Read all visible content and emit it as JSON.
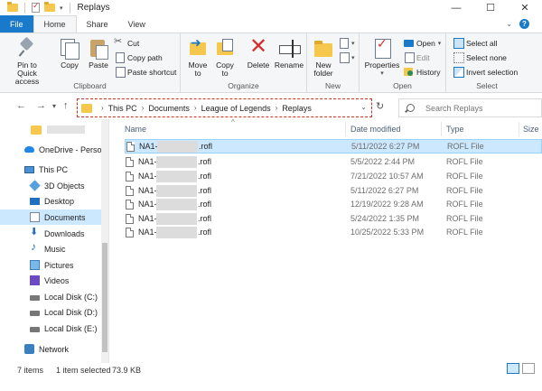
{
  "window": {
    "title": "Replays",
    "controls": {
      "minimize": "—",
      "maximize": "☐",
      "close": "✕"
    }
  },
  "ribbon_tabs": [
    "File",
    "Home",
    "Share",
    "View"
  ],
  "ribbon": {
    "clipboard": {
      "label": "Clipboard",
      "pin": "Pin to Quick access",
      "pin_l1": "Pin to Quick",
      "pin_l2": "access",
      "copy": "Copy",
      "paste": "Paste",
      "cut": "Cut",
      "copy_path": "Copy path",
      "paste_shortcut": "Paste shortcut"
    },
    "organize": {
      "label": "Organize",
      "move_to_l1": "Move",
      "move_to_l2": "to",
      "copy_to_l1": "Copy",
      "copy_to_l2": "to",
      "delete": "Delete",
      "rename": "Rename"
    },
    "new": {
      "label": "New",
      "new_folder_l1": "New",
      "new_folder_l2": "folder"
    },
    "open": {
      "label": "Open",
      "properties": "Properties",
      "open": "Open",
      "edit": "Edit",
      "history": "History"
    },
    "select": {
      "label": "Select",
      "select_all": "Select all",
      "select_none": "Select none",
      "invert_selection": "Invert selection"
    }
  },
  "address": {
    "breadcrumbs": [
      "This PC",
      "Documents",
      "League of Legends",
      "Replays"
    ]
  },
  "search": {
    "placeholder": "Search Replays"
  },
  "nav_pane": {
    "items": [
      {
        "label": "OneDrive - Persor",
        "icon": "cloud-icon"
      },
      {
        "label": "This PC",
        "icon": "computer-icon"
      },
      {
        "label": "3D Objects",
        "icon": "cube-icon"
      },
      {
        "label": "Desktop",
        "icon": "desktop-icon"
      },
      {
        "label": "Documents",
        "icon": "document-icon",
        "selected": true
      },
      {
        "label": "Downloads",
        "icon": "download-icon"
      },
      {
        "label": "Music",
        "icon": "music-icon"
      },
      {
        "label": "Pictures",
        "icon": "picture-icon"
      },
      {
        "label": "Videos",
        "icon": "video-icon"
      },
      {
        "label": "Local Disk (C:)",
        "icon": "drive-icon"
      },
      {
        "label": "Local Disk (D:)",
        "icon": "drive-icon"
      },
      {
        "label": "Local Disk (E:)",
        "icon": "drive-icon"
      },
      {
        "label": "Network",
        "icon": "network-icon"
      }
    ]
  },
  "file_list": {
    "columns": [
      "Name",
      "Date modified",
      "Type",
      "Size"
    ],
    "rows": [
      {
        "name_prefix": "NA1-",
        "name_suffix": ".rofl",
        "date": "5/11/2022 6:27 PM",
        "type": "ROFL File",
        "selected": true
      },
      {
        "name_prefix": "NA1-",
        "name_suffix": ".rofl",
        "date": "5/5/2022 2:44 PM",
        "type": "ROFL File"
      },
      {
        "name_prefix": "NA1-",
        "name_suffix": ".rofl",
        "date": "7/21/2022 10:57 AM",
        "type": "ROFL File"
      },
      {
        "name_prefix": "NA1-",
        "name_suffix": ".rofl",
        "date": "5/11/2022 6:27 PM",
        "type": "ROFL File"
      },
      {
        "name_prefix": "NA1-",
        "name_suffix": ".rofl",
        "date": "12/19/2022 9:28 AM",
        "type": "ROFL File"
      },
      {
        "name_prefix": "NA1-",
        "name_suffix": ".rofl",
        "date": "5/24/2022 1:35 PM",
        "type": "ROFL File"
      },
      {
        "name_prefix": "NA1-",
        "name_suffix": ".rofl",
        "date": "10/25/2022 5:33 PM",
        "type": "ROFL File"
      }
    ]
  },
  "status": {
    "item_count": "7 items",
    "selection": "1 item selected",
    "size": "73.9 KB"
  },
  "colors": {
    "accent": "#1979ca",
    "selection": "#cce8ff",
    "highlight_border": "#d32f2f"
  }
}
